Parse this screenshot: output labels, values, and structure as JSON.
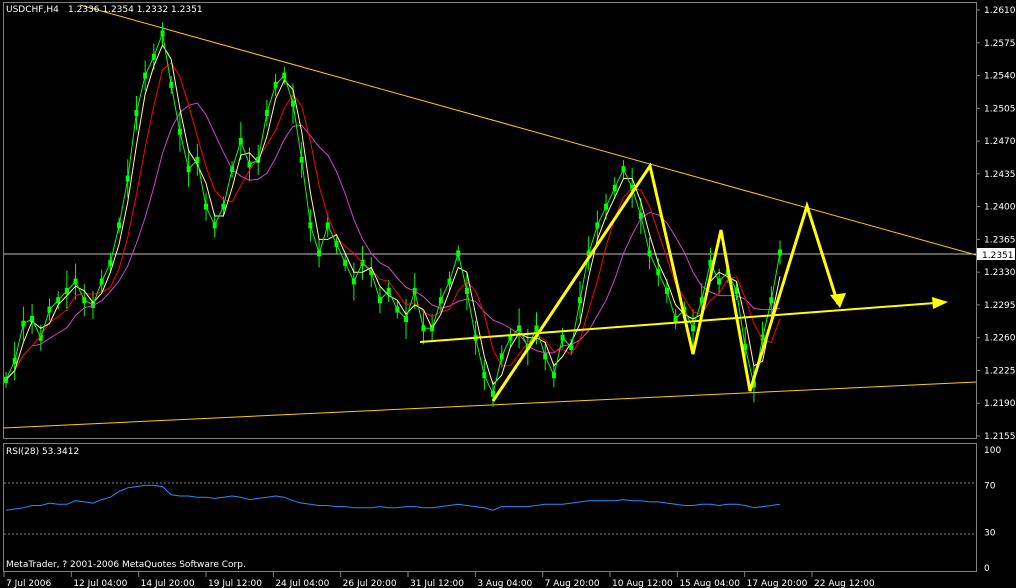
{
  "header": {
    "symbol_timeframe": "USDCHF,H4",
    "ohlc": "1.2336 1.2354 1.2332 1.2351"
  },
  "rsi_panel": {
    "label": "RSI(28) 53.3412",
    "ticks": [
      "100",
      "70",
      "30",
      "0"
    ]
  },
  "copyright": "MetaTrader, ? 2001-2006 MetaQuotes Software Corp.",
  "colors": {
    "background": "#000000",
    "grid": "#808080",
    "bars": "#00ff00",
    "ma_fast": "#ffff99",
    "ma_mid": "#ff0000",
    "ma_slow": "#cc44cc",
    "trendlines": "#ffcc00",
    "pattern": "#ffff00",
    "rsi": "#1e90ff",
    "rsi_levels": "#808080"
  },
  "chart_data": {
    "type": "line",
    "title": "USDCHF,H4",
    "price_ticks": [
      "1.2610",
      "1.2575",
      "1.2540",
      "1.2505",
      "1.2470",
      "1.2435",
      "1.2400",
      "1.2365",
      "1.2330",
      "1.2295",
      "1.2260",
      "1.2225",
      "1.2190",
      "1.2155"
    ],
    "current_price": "1.2351",
    "ylim": [
      1.2155,
      1.261
    ],
    "x_ticks": [
      "7 Jul 2006",
      "12 Jul 04:00",
      "14 Jul 20:00",
      "19 Jul 12:00",
      "24 Jul 04:00",
      "26 Jul 20:00",
      "31 Jul 12:00",
      "3 Aug 04:00",
      "7 Aug 20:00",
      "10 Aug 12:00",
      "15 Aug 04:00",
      "17 Aug 20:00",
      "22 Aug 12:00"
    ],
    "series": [
      {
        "values": [
          1.2215,
          1.2235,
          1.2275,
          1.228,
          1.226,
          1.229,
          1.23,
          1.231,
          1.232,
          1.23,
          1.2295,
          1.232,
          1.234,
          1.238,
          1.243,
          1.25,
          1.254,
          1.256,
          1.2585,
          1.253,
          1.248,
          1.244,
          1.245,
          1.24,
          1.238,
          1.24,
          1.244,
          1.247,
          1.2445,
          1.245,
          1.25,
          1.253,
          1.254,
          1.251,
          1.245,
          1.238,
          1.235,
          1.238,
          1.236,
          1.234,
          1.232,
          1.234,
          1.233,
          1.23,
          1.231,
          1.229,
          1.228,
          1.231,
          1.227,
          1.227,
          1.23,
          1.232,
          1.235,
          1.231,
          1.226,
          1.222,
          1.22,
          1.224,
          1.226,
          1.227,
          1.225,
          1.227,
          1.224,
          1.222,
          1.226,
          1.225,
          1.23,
          1.235,
          1.238,
          1.24,
          1.242,
          1.244,
          1.242,
          1.239,
          1.235,
          1.233,
          1.231,
          1.228,
          1.229,
          1.227,
          1.23,
          1.234,
          1.232,
          1.233,
          1.231,
          1.225,
          1.221,
          1.226,
          1.23,
          1.2351
        ]
      }
    ],
    "rsi": {
      "ylim": [
        0,
        100
      ],
      "levels": [
        70,
        30
      ],
      "values": [
        49,
        50,
        51,
        53,
        53,
        55,
        54,
        54,
        57,
        56,
        55,
        58,
        60,
        65,
        68,
        69,
        70,
        70,
        69,
        62,
        61,
        61,
        60,
        60,
        59,
        60,
        61,
        60,
        58,
        59,
        60,
        61,
        60,
        57,
        55,
        54,
        53,
        53,
        52,
        52,
        51,
        51,
        51,
        52,
        51,
        51,
        52,
        52,
        51,
        51,
        52,
        53,
        54,
        53,
        52,
        51,
        49,
        52,
        52,
        52,
        52,
        53,
        54,
        54,
        54,
        55,
        56,
        57,
        57,
        57,
        57,
        58,
        57,
        57,
        56,
        56,
        55,
        54,
        53,
        53,
        54,
        54,
        53,
        54,
        54,
        53,
        51,
        52,
        53,
        54
      ]
    }
  }
}
